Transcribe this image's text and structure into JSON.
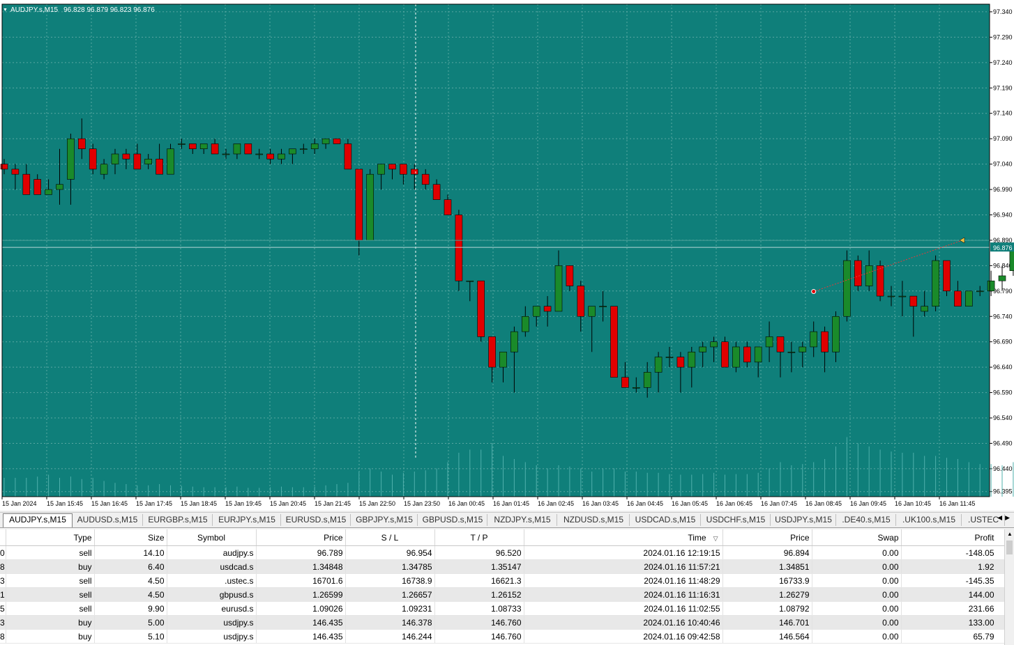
{
  "chart": {
    "symbol_header": "AUDJPY.s,M15",
    "ohlc_header": "96.828 96.879 96.823 96.876",
    "colors": {
      "background": "#0f7f7a",
      "grid": "#5aa8a3",
      "bull": "#1a8a2a",
      "bear": "#e00000",
      "wick": "#000000",
      "volume": "#4fb0ac",
      "text": "#ffffff"
    },
    "price_labels": [
      "97.340",
      "97.290",
      "97.240",
      "97.190",
      "97.140",
      "97.090",
      "97.040",
      "96.990",
      "96.940",
      "96.890",
      "96.840",
      "96.790",
      "96.740",
      "96.690",
      "96.640",
      "96.590",
      "96.540",
      "96.490",
      "96.440",
      "96.395"
    ],
    "current_price_label": "96.876",
    "time_labels": [
      "15 Jan 2024",
      "15 Jan 15:45",
      "15 Jan 16:45",
      "15 Jan 17:45",
      "15 Jan 18:45",
      "15 Jan 19:45",
      "15 Jan 20:45",
      "15 Jan 21:45",
      "15 Jan 22:50",
      "15 Jan 23:50",
      "16 Jan 00:45",
      "16 Jan 01:45",
      "16 Jan 02:45",
      "16 Jan 03:45",
      "16 Jan 04:45",
      "16 Jan 05:45",
      "16 Jan 06:45",
      "16 Jan 07:45",
      "16 Jan 08:45",
      "16 Jan 09:45",
      "16 Jan 10:45",
      "16 Jan 11:45"
    ],
    "price_range": [
      96.385,
      97.355
    ],
    "candles": [
      [
        97.04,
        97.05,
        97.02,
        97.03
      ],
      [
        97.03,
        97.04,
        96.99,
        97.02
      ],
      [
        97.02,
        97.04,
        96.98,
        96.98
      ],
      [
        97.01,
        97.02,
        96.98,
        96.98
      ],
      [
        96.98,
        97.01,
        96.98,
        96.99
      ],
      [
        96.99,
        97.07,
        96.96,
        97.0
      ],
      [
        97.01,
        97.1,
        96.96,
        97.09
      ],
      [
        97.09,
        97.13,
        97.05,
        97.07
      ],
      [
        97.07,
        97.08,
        97.02,
        97.03
      ],
      [
        97.02,
        97.05,
        97.01,
        97.04
      ],
      [
        97.04,
        97.07,
        97.02,
        97.06
      ],
      [
        97.06,
        97.07,
        97.03,
        97.05
      ],
      [
        97.06,
        97.08,
        97.03,
        97.03
      ],
      [
        97.04,
        97.06,
        97.03,
        97.05
      ],
      [
        97.05,
        97.08,
        97.02,
        97.02
      ],
      [
        97.02,
        97.08,
        97.02,
        97.07
      ],
      [
        97.08,
        97.09,
        97.07,
        97.08
      ],
      [
        97.08,
        97.08,
        97.06,
        97.07
      ],
      [
        97.07,
        97.08,
        97.06,
        97.08
      ],
      [
        97.08,
        97.09,
        97.06,
        97.06
      ],
      [
        97.06,
        97.07,
        97.05,
        97.06
      ],
      [
        97.06,
        97.07,
        97.05,
        97.08
      ],
      [
        97.08,
        97.08,
        97.06,
        97.06
      ],
      [
        97.06,
        97.07,
        97.05,
        97.06
      ],
      [
        97.06,
        97.07,
        97.04,
        97.05
      ],
      [
        97.05,
        97.07,
        97.04,
        97.06
      ],
      [
        97.06,
        97.07,
        97.04,
        97.07
      ],
      [
        97.07,
        97.08,
        97.06,
        97.07
      ],
      [
        97.07,
        97.09,
        97.06,
        97.08
      ],
      [
        97.08,
        97.09,
        97.07,
        97.09
      ],
      [
        97.09,
        97.09,
        97.08,
        97.08
      ],
      [
        97.08,
        97.09,
        97.03,
        97.03
      ],
      [
        97.03,
        97.02,
        96.86,
        96.89
      ],
      [
        96.89,
        97.03,
        96.89,
        97.02
      ],
      [
        97.02,
        97.04,
        96.99,
        97.04
      ],
      [
        97.04,
        97.04,
        97.01,
        97.03
      ],
      [
        97.04,
        97.04,
        97.0,
        97.02
      ],
      [
        97.03,
        97.04,
        96.99,
        97.02
      ],
      [
        97.02,
        97.03,
        96.99,
        97.0
      ],
      [
        97.0,
        97.01,
        96.98,
        96.97
      ],
      [
        96.97,
        96.98,
        96.94,
        96.94
      ],
      [
        96.94,
        96.95,
        96.79,
        96.81
      ],
      [
        96.81,
        96.81,
        96.77,
        96.81
      ],
      [
        96.81,
        96.81,
        96.69,
        96.7
      ],
      [
        96.7,
        96.7,
        96.61,
        96.64
      ],
      [
        96.64,
        96.67,
        96.61,
        96.67
      ],
      [
        96.67,
        96.72,
        96.59,
        96.71
      ],
      [
        96.71,
        96.76,
        96.7,
        96.74
      ],
      [
        96.74,
        96.76,
        96.72,
        96.76
      ],
      [
        96.76,
        96.78,
        96.72,
        96.75
      ],
      [
        96.75,
        96.87,
        96.75,
        96.84
      ],
      [
        96.84,
        96.84,
        96.79,
        96.8
      ],
      [
        96.8,
        96.81,
        96.71,
        96.74
      ],
      [
        96.74,
        96.76,
        96.67,
        96.76
      ],
      [
        96.76,
        96.79,
        96.73,
        96.76
      ],
      [
        96.76,
        96.76,
        96.62,
        96.62
      ],
      [
        96.62,
        96.65,
        96.6,
        96.6
      ],
      [
        96.6,
        96.62,
        96.59,
        96.6
      ],
      [
        96.6,
        96.65,
        96.58,
        96.63
      ],
      [
        96.63,
        96.67,
        96.59,
        96.66
      ],
      [
        96.66,
        96.68,
        96.64,
        96.66
      ],
      [
        96.66,
        96.67,
        96.59,
        96.64
      ],
      [
        96.64,
        96.68,
        96.6,
        96.67
      ],
      [
        96.67,
        96.69,
        96.64,
        96.68
      ],
      [
        96.68,
        96.7,
        96.65,
        96.69
      ],
      [
        96.69,
        96.7,
        96.64,
        96.64
      ],
      [
        96.64,
        96.69,
        96.63,
        96.68
      ],
      [
        96.68,
        96.69,
        96.64,
        96.65
      ],
      [
        96.65,
        96.68,
        96.62,
        96.68
      ],
      [
        96.68,
        96.73,
        96.65,
        96.7
      ],
      [
        96.7,
        96.7,
        96.62,
        96.67
      ],
      [
        96.67,
        96.69,
        96.63,
        96.67
      ],
      [
        96.67,
        96.69,
        96.64,
        96.68
      ],
      [
        96.68,
        96.73,
        96.66,
        96.71
      ],
      [
        96.71,
        96.72,
        96.63,
        96.67
      ],
      [
        96.67,
        96.75,
        96.65,
        96.74
      ],
      [
        96.74,
        96.87,
        96.73,
        96.85
      ],
      [
        96.85,
        96.86,
        96.79,
        96.8
      ],
      [
        96.8,
        96.87,
        96.79,
        96.84
      ],
      [
        96.84,
        96.85,
        96.77,
        96.78
      ],
      [
        96.78,
        96.8,
        96.76,
        96.78
      ],
      [
        96.78,
        96.81,
        96.74,
        96.78
      ],
      [
        96.78,
        96.78,
        96.7,
        96.76
      ],
      [
        96.75,
        96.79,
        96.74,
        96.76
      ],
      [
        96.76,
        96.86,
        96.75,
        96.85
      ],
      [
        96.85,
        96.85,
        96.78,
        96.79
      ],
      [
        96.79,
        96.81,
        96.76,
        96.76
      ],
      [
        96.76,
        96.79,
        96.76,
        96.79
      ],
      [
        96.79,
        96.8,
        96.78,
        96.79
      ],
      [
        96.79,
        96.83,
        96.78,
        96.81
      ],
      [
        96.81,
        96.84,
        96.79,
        96.82
      ],
      [
        96.83,
        96.88,
        96.82,
        96.876
      ]
    ],
    "volumes": [
      0.3,
      0.3,
      0.3,
      0.32,
      0.35,
      0.3,
      0.32,
      0.28,
      0.3,
      0.25,
      0.22,
      0.2,
      0.18,
      0.18,
      0.2,
      0.18,
      0.17,
      0.16,
      0.15,
      0.15,
      0.15,
      0.16,
      0.14,
      0.14,
      0.15,
      0.16,
      0.15,
      0.15,
      0.16,
      0.18,
      0.2,
      0.22,
      0.4,
      0.45,
      0.4,
      0.35,
      0.38,
      0.4,
      0.42,
      0.45,
      0.55,
      0.7,
      0.75,
      0.75,
      0.85,
      0.65,
      0.6,
      0.55,
      0.5,
      0.45,
      0.5,
      0.48,
      0.45,
      0.4,
      0.45,
      0.45,
      0.4,
      0.4,
      0.38,
      0.38,
      0.36,
      0.35,
      0.35,
      0.36,
      0.38,
      0.35,
      0.36,
      0.36,
      0.38,
      0.45,
      0.55,
      0.5,
      0.52,
      0.55,
      0.6,
      0.8,
      0.95,
      0.85,
      0.8,
      0.75,
      0.72,
      0.7,
      0.7,
      0.65,
      0.65,
      0.62,
      0.6,
      0.55,
      0.52,
      0.52,
      0.5,
      0.55,
      0.5
    ]
  },
  "tabs": {
    "items": [
      "AUDJPY.s,M15",
      "AUDUSD.s,M15",
      "EURGBP.s,M15",
      "EURJPY.s,M15",
      "EURUSD.s,M15",
      "GBPJPY.s,M15",
      "GBPUSD.s,M15",
      "NZDJPY.s,M15",
      "NZDUSD.s,M15",
      "USDCAD.s,M15",
      "USDCHF.s,M15",
      "USDJPY.s,M15",
      ".DE40.s,M15",
      ".UK100.s,M15",
      ".USTEC"
    ],
    "active_index": 0
  },
  "trade_table": {
    "headers": [
      "Type",
      "Size",
      "Symbol",
      "Price",
      "S / L",
      "T / P",
      "Time",
      "Price",
      "Swap",
      "Profit"
    ],
    "sort_indicator": "▽",
    "rows": [
      {
        "id": "0",
        "type": "sell",
        "size": "14.10",
        "symbol": "audjpy.s",
        "price": "96.789",
        "sl": "96.954",
        "tp": "96.520",
        "time": "2024.01.16 12:19:15",
        "cur_price": "96.894",
        "swap": "0.00",
        "profit": "-148.05"
      },
      {
        "id": "8",
        "type": "buy",
        "size": "6.40",
        "symbol": "usdcad.s",
        "price": "1.34848",
        "sl": "1.34785",
        "tp": "1.35147",
        "time": "2024.01.16 11:57:21",
        "cur_price": "1.34851",
        "swap": "0.00",
        "profit": "1.92"
      },
      {
        "id": "3",
        "type": "sell",
        "size": "4.50",
        "symbol": ".ustec.s",
        "price": "16701.6",
        "sl": "16738.9",
        "tp": "16621.3",
        "time": "2024.01.16 11:48:29",
        "cur_price": "16733.9",
        "swap": "0.00",
        "profit": "-145.35"
      },
      {
        "id": "1",
        "type": "sell",
        "size": "4.50",
        "symbol": "gbpusd.s",
        "price": "1.26599",
        "sl": "1.26657",
        "tp": "1.26152",
        "time": "2024.01.16 11:16:31",
        "cur_price": "1.26279",
        "swap": "0.00",
        "profit": "144.00"
      },
      {
        "id": "5",
        "type": "sell",
        "size": "9.90",
        "symbol": "eurusd.s",
        "price": "1.09026",
        "sl": "1.09231",
        "tp": "1.08733",
        "time": "2024.01.16 11:02:55",
        "cur_price": "1.08792",
        "swap": "0.00",
        "profit": "231.66"
      },
      {
        "id": "3",
        "type": "buy",
        "size": "5.00",
        "symbol": "usdjpy.s",
        "price": "146.435",
        "sl": "146.378",
        "tp": "146.760",
        "time": "2024.01.16 10:40:46",
        "cur_price": "146.701",
        "swap": "0.00",
        "profit": "133.00"
      },
      {
        "id": "8",
        "type": "buy",
        "size": "5.10",
        "symbol": "usdjpy.s",
        "price": "146.435",
        "sl": "146.244",
        "tp": "146.760",
        "time": "2024.01.16 09:42:58",
        "cur_price": "146.564",
        "swap": "0.00",
        "profit": "65.79"
      }
    ]
  }
}
